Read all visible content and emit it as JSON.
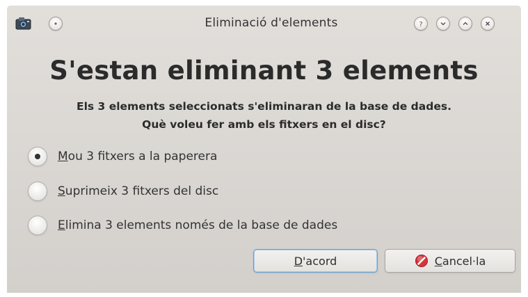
{
  "window": {
    "title": "Eliminació d'elements"
  },
  "dialog": {
    "heading": "S'estan eliminant 3 elements",
    "message_line1": "Els 3 elements seleccionats s'eliminaran de la base de dades.",
    "message_line2": "Què voleu fer amb els fitxers en el disc?"
  },
  "options": [
    {
      "accel": "M",
      "rest": "ou 3 fitxers a la paperera",
      "selected": true
    },
    {
      "accel": "S",
      "rest": "uprimeix 3 fitxers del disc",
      "selected": false
    },
    {
      "accel": "E",
      "rest": "limina 3 elements només de la base de dades",
      "selected": false
    }
  ],
  "buttons": {
    "ok": {
      "accel": "D",
      "rest": "'acord"
    },
    "cancel": {
      "accel": "C",
      "rest": "ancel·la"
    }
  },
  "icons": {
    "app": "digikam-app-icon",
    "menu": "window-menu-icon",
    "help": "help-icon",
    "minimize": "minimize-icon",
    "maximize": "maximize-icon",
    "close": "close-icon",
    "cancel": "cancel-icon"
  },
  "colors": {
    "window_bg": "#d9d6d2",
    "focus_border": "#6aa0d4",
    "cancel_icon": "#d8343a"
  }
}
